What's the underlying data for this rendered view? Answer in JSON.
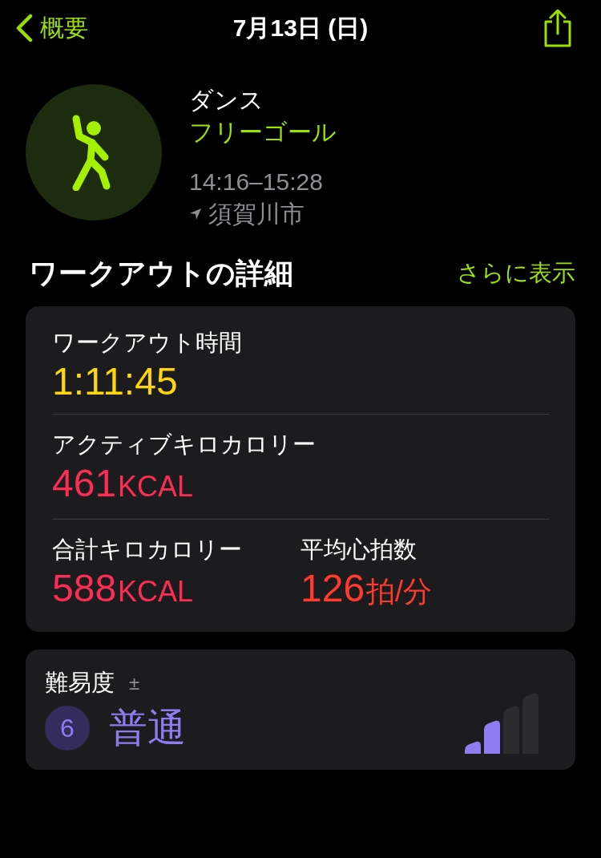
{
  "nav": {
    "back_label": "概要",
    "title": "7月13日 (日)"
  },
  "workout": {
    "type": "ダンス",
    "goal": "フリーゴール",
    "time_range": "14:16–15:28",
    "location": "須賀川市"
  },
  "section": {
    "title": "ワークアウトの詳細",
    "more_link": "さらに表示"
  },
  "metric_rows": [
    [
      {
        "label": "ワークアウト時間",
        "value": "1:11:45",
        "color": "#ffd60a"
      }
    ],
    [
      {
        "label": "アクティブキロカロリー",
        "value": "461",
        "unit": "KCAL",
        "color": "#fa2d55"
      }
    ],
    [
      {
        "label": "合計キロカロリー",
        "value": "588",
        "unit": "KCAL",
        "color": "#fa2d55"
      },
      {
        "label": "平均心拍数",
        "value": "126",
        "unit": "拍/分",
        "color": "#ff3b30"
      }
    ]
  ],
  "effort": {
    "label": "難易度",
    "adjust_icon": "±",
    "score": "6",
    "rating": "普通",
    "bars": [
      {
        "filled": true
      },
      {
        "filled": true
      },
      {
        "filled": false
      },
      {
        "filled": false
      }
    ]
  }
}
